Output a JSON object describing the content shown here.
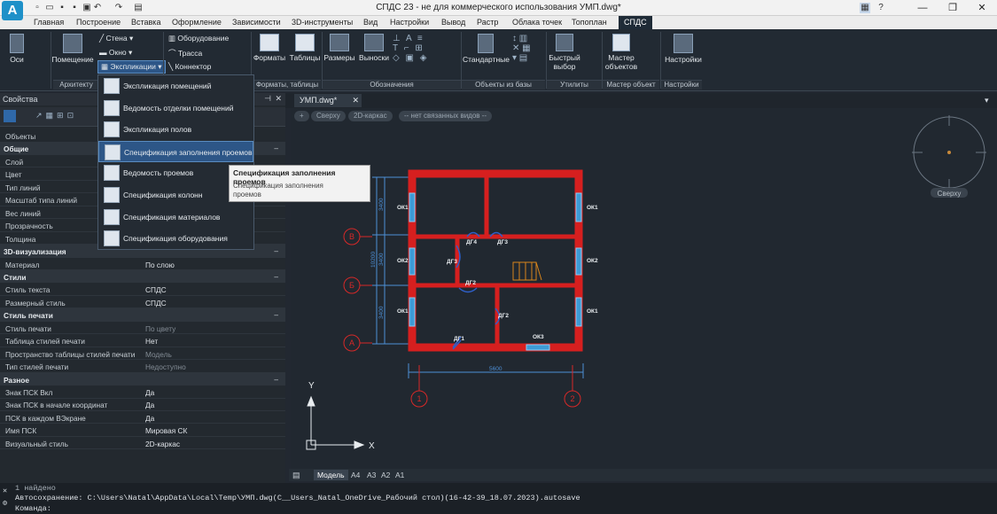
{
  "title_bar": {
    "title": "СПДС 23 - не для коммерческого использования УМП.dwg*",
    "app_icon": "А",
    "help": "?"
  },
  "menu": [
    "Главная",
    "Построение",
    "Вставка",
    "Оформление",
    "Зависимости",
    "3D-инструменты",
    "Вид",
    "Настройки",
    "Вывод",
    "Растр",
    "Облака точек",
    "Топоплан",
    "СПДС"
  ],
  "ribbon": {
    "axes": "Оси",
    "room": "Помещение",
    "wall": "Стена",
    "window": "Окно",
    "explication": "Экспликации",
    "equipment": "Оборудование",
    "route": "Трасса",
    "connector": "Коннектор",
    "formats": "Форматы",
    "tables": "Таблицы",
    "sizes": "Размеры",
    "leaders": "Выноски",
    "standard": "Стандартные",
    "quick_select": "Быстрый",
    "quick_select2": "выбор",
    "master": "Мастер",
    "master2": "объектов",
    "settings": "Настройки",
    "panels": {
      "arch": "Архитекту",
      "formats": "Форматы, таблицы",
      "designations": "Обозначения",
      "db_objects": "Объекты из базы",
      "utils": "Утилиты",
      "master": "Мастер объект",
      "settings": "Настройки"
    }
  },
  "properties": {
    "header": "Свойства",
    "rows": [
      {
        "k": "Объекты",
        "v": "",
        "sec": false
      },
      {
        "k": "Общие",
        "v": "",
        "sec": true
      },
      {
        "k": "Слой",
        "v": "",
        "sec": false
      },
      {
        "k": "Цвет",
        "v": "",
        "sec": false
      },
      {
        "k": "Тип линий",
        "v": "",
        "sec": false
      },
      {
        "k": "Масштаб типа линий",
        "v": "",
        "sec": false
      },
      {
        "k": "Вес линий",
        "v": "",
        "sec": false
      },
      {
        "k": "Прозрачность",
        "v": "",
        "sec": false
      },
      {
        "k": "Толщина",
        "v": "",
        "sec": false
      },
      {
        "k": "3D-визуализация",
        "v": "",
        "sec": true
      },
      {
        "k": "Материал",
        "v": "По слою",
        "sec": false
      },
      {
        "k": "Стили",
        "v": "",
        "sec": true
      },
      {
        "k": "Стиль текста",
        "v": "СПДС",
        "sec": false
      },
      {
        "k": "Размерный стиль",
        "v": "СПДС",
        "sec": false
      },
      {
        "k": "Стиль печати",
        "v": "",
        "sec": true
      },
      {
        "k": "Стиль печати",
        "v": "По цвету",
        "sec": false,
        "dim": true
      },
      {
        "k": "Таблица стилей печати",
        "v": "Нет",
        "sec": false
      },
      {
        "k": "Пространство таблицы стилей печати",
        "v": "Модель",
        "sec": false,
        "dim": true
      },
      {
        "k": "Тип стилей печати",
        "v": "Недоступно",
        "sec": false,
        "dim": true
      },
      {
        "k": "Разное",
        "v": "",
        "sec": true
      },
      {
        "k": "Знак ПСК Вкл",
        "v": "Да",
        "sec": false
      },
      {
        "k": "Знак ПСК в начале координат",
        "v": "Да",
        "sec": false
      },
      {
        "k": "ПСК в каждом ВЭкране",
        "v": "Да",
        "sec": false
      },
      {
        "k": "Имя ПСК",
        "v": "Мировая СК",
        "sec": false
      },
      {
        "k": "Визуальный стиль",
        "v": "2D-каркас",
        "sec": false
      }
    ]
  },
  "dropdown": [
    {
      "label": "Экспликация помещений",
      "hl": false
    },
    {
      "label": "Ведомость отделки помещений",
      "hl": false
    },
    {
      "label": "Экспликация полов",
      "hl": false
    },
    {
      "label": "Спецификация заполнения проемов",
      "hl": true
    },
    {
      "label": "Ведомость проемов",
      "hl": false
    },
    {
      "label": "Спецификация колонн",
      "hl": false
    },
    {
      "label": "Спецификация материалов",
      "hl": false
    },
    {
      "label": "Спецификация оборудования",
      "hl": false
    }
  ],
  "tooltip": {
    "title": "Спецификация заполнения проемов",
    "desc": "Спецификация заполнения проемов"
  },
  "doc_tab": "УМП.dwg*",
  "view_controls": {
    "plus": "+",
    "view": "Сверху",
    "style": "2D-каркас",
    "named": "-- нет связанных видов --"
  },
  "viewcube": "Сверху",
  "drawing": {
    "axes_rows": [
      "В",
      "Б",
      "А"
    ],
    "axes_cols": [
      "1",
      "2"
    ],
    "dims": {
      "total_h": "10200",
      "h1": "3400",
      "h2": "3400",
      "h3": "3400",
      "total_w": "5600"
    },
    "windows": [
      "ОК1",
      "ОК1",
      "ОК2",
      "ОК2",
      "ОК1",
      "ОК1",
      "ОК3"
    ],
    "doors": [
      "ДГ1",
      "ДГ2",
      "ДГ2",
      "ДГ3",
      "ДГ4",
      "ДГ3"
    ],
    "ucs_x": "X",
    "ucs_y": "Y"
  },
  "layout_tabs": [
    "Модель",
    "А4",
    "А3",
    "А2",
    "А1"
  ],
  "command": {
    "line1": "1 найдено",
    "line2": "Автосохранение: C:\\Users\\Natal\\AppData\\Local\\Temp\\УМП.dwg(C__Users_Natal_OneDrive_Рабочий стол)(16-42-39_18.07.2023).autosave",
    "prompt": "Команда:"
  }
}
